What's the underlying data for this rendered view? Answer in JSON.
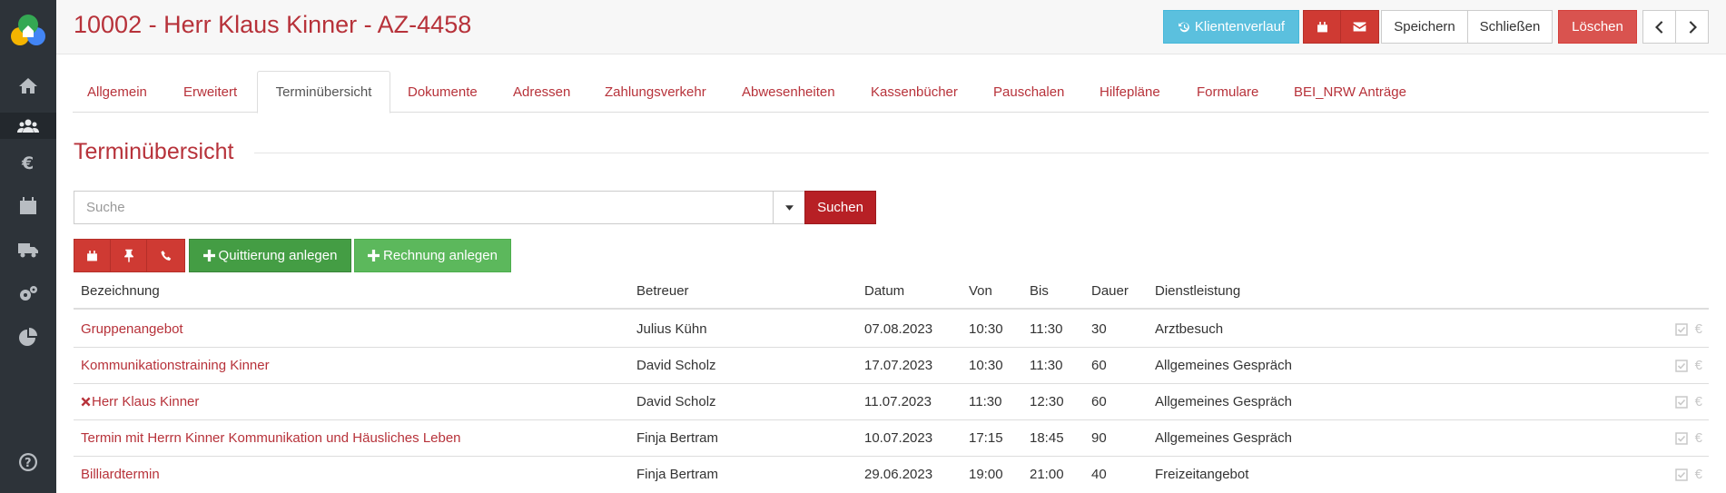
{
  "header": {
    "title": "10002 - Herr Klaus Kinner - AZ-4458",
    "buttons": {
      "klientenverlauf": "Klientenverlauf",
      "speichern": "Speichern",
      "schliessen": "Schließen",
      "loeschen": "Löschen"
    }
  },
  "sidebar": {
    "items": [
      {
        "name": "home",
        "icon": "home-icon"
      },
      {
        "name": "clients",
        "icon": "users-icon",
        "active": true
      },
      {
        "name": "finance",
        "icon": "euro-icon"
      },
      {
        "name": "calendar",
        "icon": "calendar-icon"
      },
      {
        "name": "transport",
        "icon": "truck-icon"
      },
      {
        "name": "settings",
        "icon": "gears-icon"
      },
      {
        "name": "statistics",
        "icon": "pie-chart-icon"
      },
      {
        "name": "help",
        "icon": "question-icon"
      }
    ]
  },
  "tabs": [
    {
      "label": "Allgemein"
    },
    {
      "label": "Erweitert"
    },
    {
      "label": "Terminübersicht",
      "active": true
    },
    {
      "label": "Dokumente"
    },
    {
      "label": "Adressen"
    },
    {
      "label": "Zahlungsverkehr"
    },
    {
      "label": "Abwesenheiten"
    },
    {
      "label": "Kassenbücher"
    },
    {
      "label": "Pauschalen"
    },
    {
      "label": "Hilfepläne"
    },
    {
      "label": "Formulare"
    },
    {
      "label": "BEI_NRW Anträge"
    }
  ],
  "section": {
    "title": "Terminübersicht"
  },
  "search": {
    "placeholder": "Suche",
    "button": "Suchen"
  },
  "actions": {
    "quittierung": "Quittierung anlegen",
    "rechnung": "Rechnung anlegen"
  },
  "table": {
    "columns": {
      "bezeichnung": "Bezeichnung",
      "betreuer": "Betreuer",
      "datum": "Datum",
      "von": "Von",
      "bis": "Bis",
      "dauer": "Dauer",
      "dienstleistung": "Dienstleistung"
    },
    "rows": [
      {
        "bezeichnung": "Gruppenangebot",
        "cancelled": false,
        "betreuer": "Julius Kühn",
        "datum": "07.08.2023",
        "von": "10:30",
        "bis": "11:30",
        "dauer": "30",
        "dienstleistung": "Arztbesuch"
      },
      {
        "bezeichnung": "Kommunikationstraining Kinner",
        "cancelled": false,
        "betreuer": "David Scholz",
        "datum": "17.07.2023",
        "von": "10:30",
        "bis": "11:30",
        "dauer": "60",
        "dienstleistung": "Allgemeines Gespräch"
      },
      {
        "bezeichnung": "Herr Klaus Kinner",
        "cancelled": true,
        "betreuer": "David Scholz",
        "datum": "11.07.2023",
        "von": "11:30",
        "bis": "12:30",
        "dauer": "60",
        "dienstleistung": "Allgemeines Gespräch"
      },
      {
        "bezeichnung": "Termin mit Herrn Kinner Kommunikation und Häusliches Leben",
        "cancelled": false,
        "betreuer": "Finja Bertram",
        "datum": "10.07.2023",
        "von": "17:15",
        "bis": "18:45",
        "dauer": "90",
        "dienstleistung": "Allgemeines Gespräch"
      },
      {
        "bezeichnung": "Billiardtermin",
        "cancelled": false,
        "betreuer": "Finja Bertram",
        "datum": "29.06.2023",
        "von": "19:00",
        "bis": "21:00",
        "dauer": "40",
        "dienstleistung": "Freizeitangebot"
      }
    ]
  },
  "colors": {
    "brand_red": "#b7323a",
    "sidebar_bg": "#2d3339",
    "info_blue": "#5bc0de",
    "success_green": "#5cb85c"
  }
}
